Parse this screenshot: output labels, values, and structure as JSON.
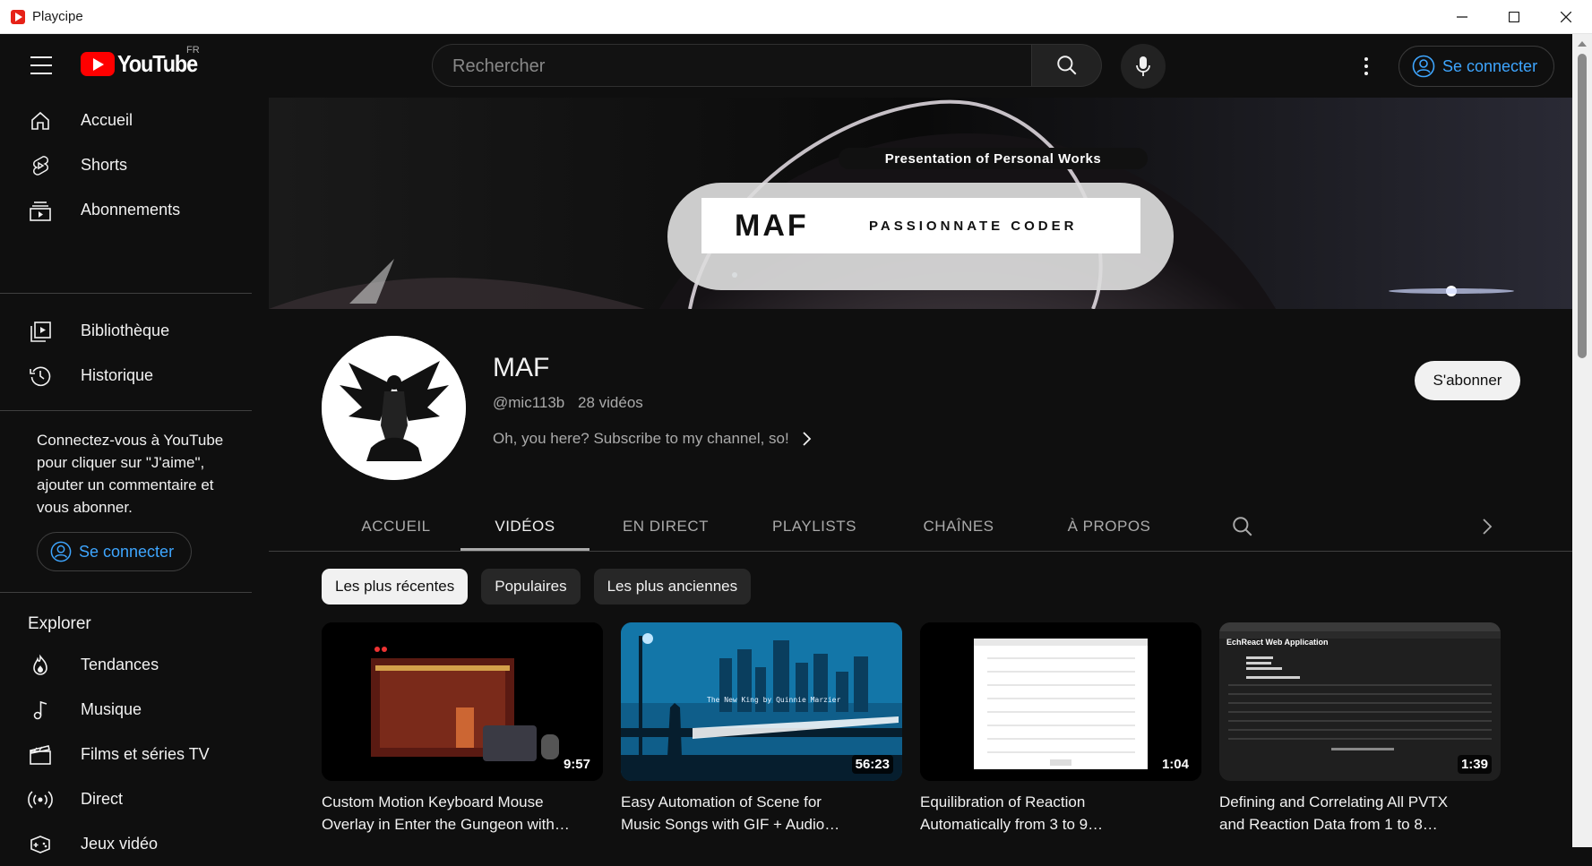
{
  "window": {
    "title": "Playcipe"
  },
  "masthead": {
    "logo_text": "YouTube",
    "country_code": "FR",
    "search_placeholder": "Rechercher",
    "signin_label": "Se connecter"
  },
  "sidebar": {
    "items": [
      {
        "label": "Accueil",
        "icon": "home-icon"
      },
      {
        "label": "Shorts",
        "icon": "shorts-icon"
      },
      {
        "label": "Abonnements",
        "icon": "subscriptions-icon"
      },
      {
        "label": "Bibliothèque",
        "icon": "library-icon"
      },
      {
        "label": "Historique",
        "icon": "history-icon"
      }
    ],
    "signin_promo": "Connectez-vous à YouTube pour cliquer sur \"J'aime\", ajouter un commentaire et vous abonner.",
    "signin_label": "Se connecter",
    "explore_title": "Explorer",
    "explore_items": [
      {
        "label": "Tendances",
        "icon": "trending-icon"
      },
      {
        "label": "Musique",
        "icon": "music-icon"
      },
      {
        "label": "Films et séries TV",
        "icon": "movies-icon"
      },
      {
        "label": "Direct",
        "icon": "live-icon"
      },
      {
        "label": "Jeux vidéo",
        "icon": "gaming-icon"
      }
    ]
  },
  "banner": {
    "tagline": "Presentation of Personal Works",
    "name": "MAF",
    "subtitle": "PASSIONNATE CODER"
  },
  "channel": {
    "name": "MAF",
    "handle": "@mic113b",
    "video_count": "28 vidéos",
    "description": "Oh, you here? Subscribe to my channel, so!",
    "subscribe_label": "S'abonner"
  },
  "tabs": [
    {
      "label": "ACCUEIL",
      "active": false
    },
    {
      "label": "VIDÉOS",
      "active": true
    },
    {
      "label": "EN DIRECT",
      "active": false
    },
    {
      "label": "PLAYLISTS",
      "active": false
    },
    {
      "label": "CHAÎNES",
      "active": false
    },
    {
      "label": "À PROPOS",
      "active": false
    }
  ],
  "chips": [
    {
      "label": "Les plus récentes",
      "selected": true
    },
    {
      "label": "Populaires",
      "selected": false
    },
    {
      "label": "Les plus anciennes",
      "selected": false
    }
  ],
  "videos": [
    {
      "title_line1": "Custom Motion Keyboard Mouse",
      "title_line2": "Overlay in Enter the Gungeon with…",
      "duration": "9:57"
    },
    {
      "title_line1": "Easy Automation of Scene for",
      "title_line2": "Music Songs with GIF + Audio…",
      "duration": "56:23",
      "thumb_text": "The New King by Quinnie Marzier"
    },
    {
      "title_line1": "Equilibration of Reaction",
      "title_line2": "Automatically from 3 to 9…",
      "duration": "1:04"
    },
    {
      "title_line1": "Defining and Correlating All PVTX",
      "title_line2": "and Reaction Data from 1 to 8…",
      "duration": "1:39",
      "thumb_text": "EchReact Web Application"
    }
  ],
  "colors": {
    "background": "#0f0f0f",
    "accent_blue": "#3ea6ff",
    "youtube_red": "#ff0000",
    "chip_bg": "#272727"
  }
}
